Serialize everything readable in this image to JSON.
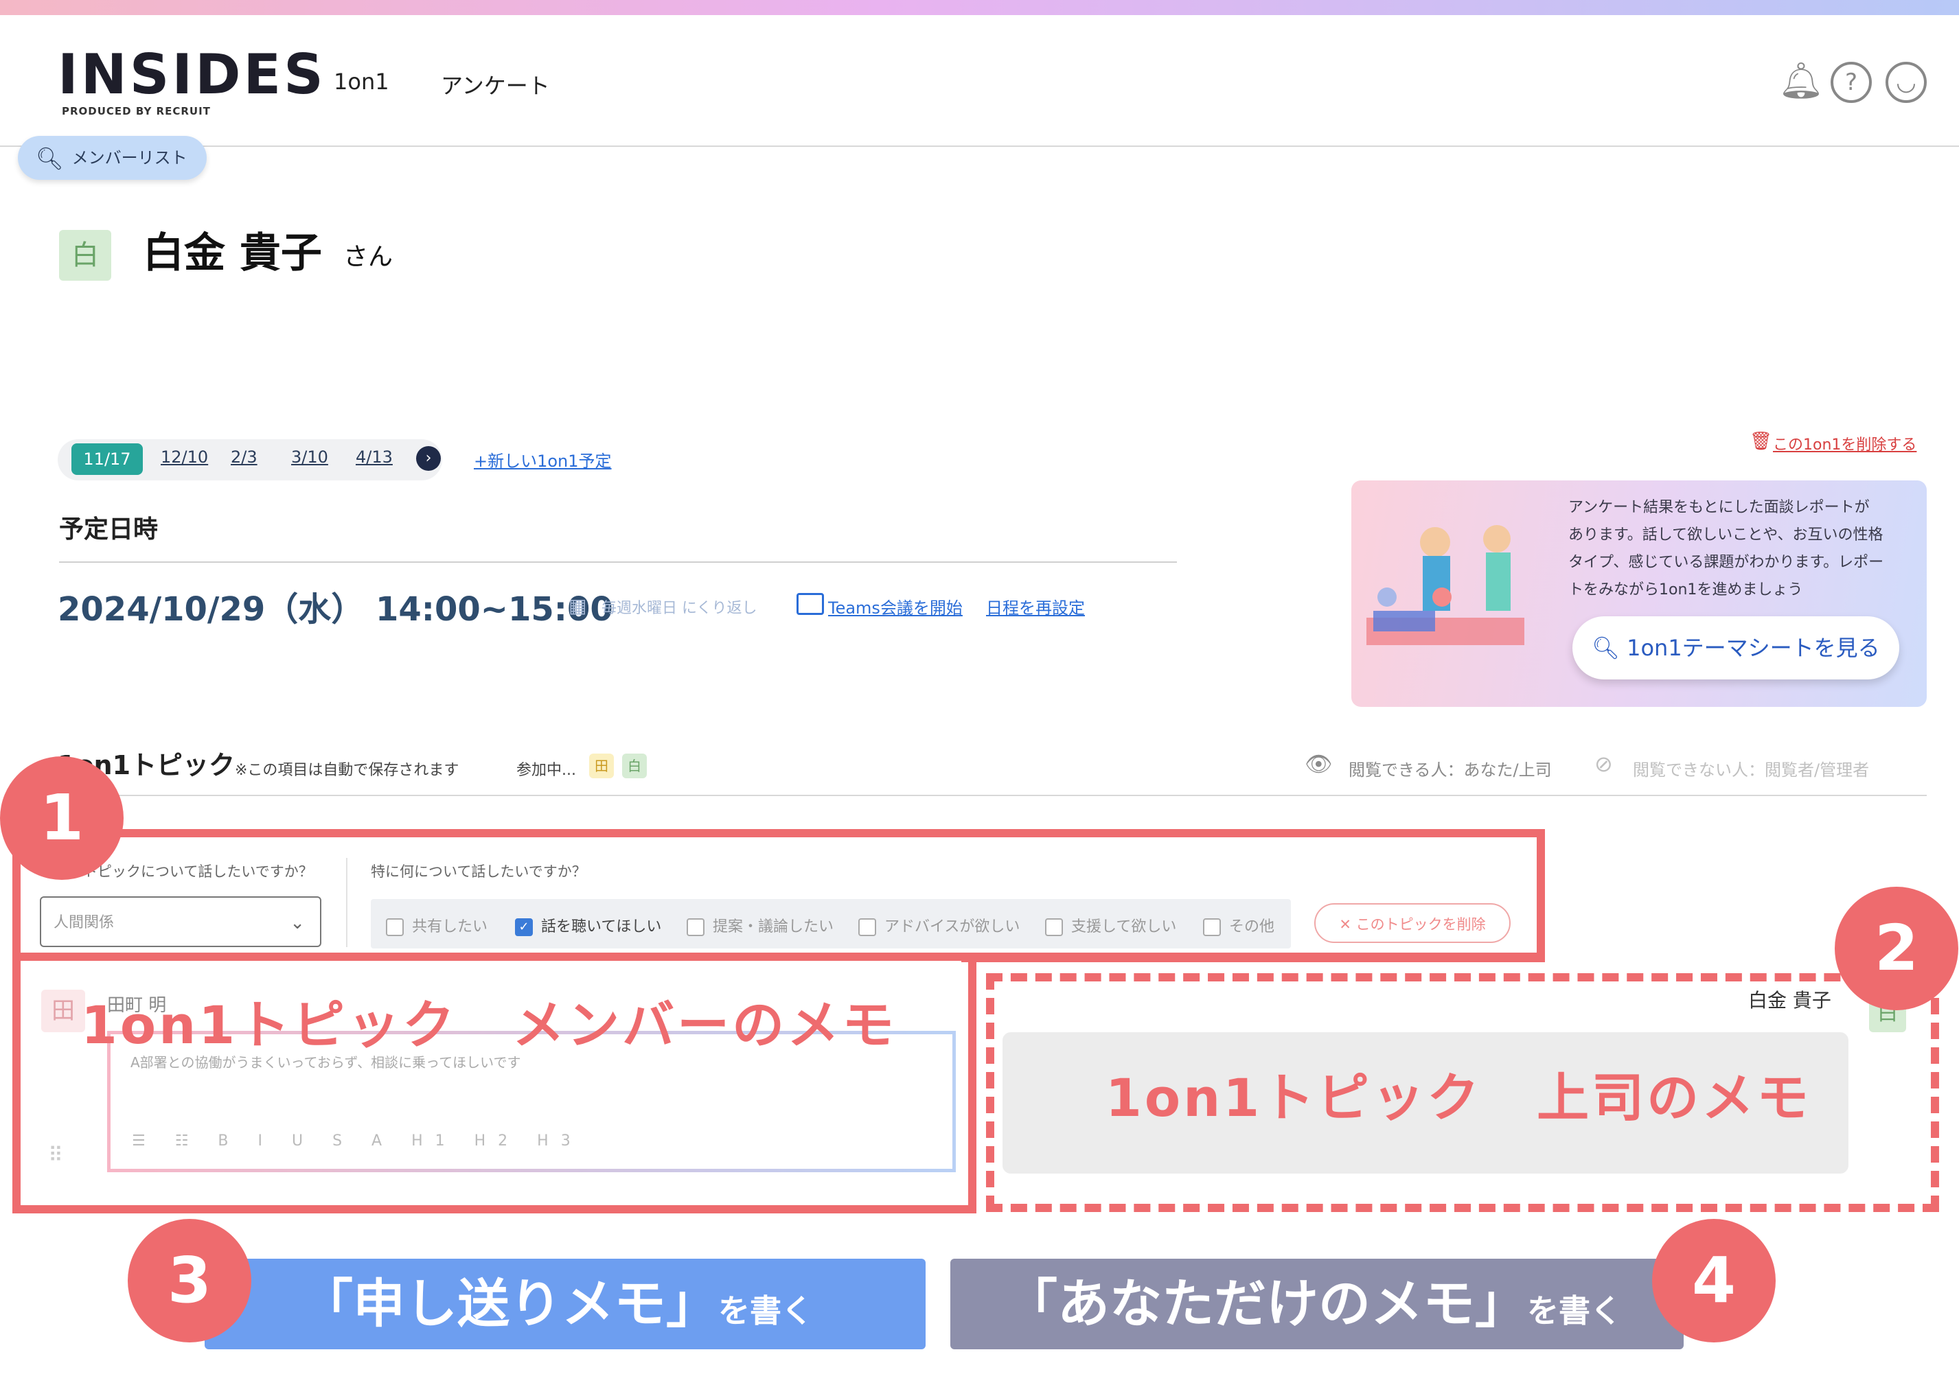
{
  "header": {
    "logo": "INSIDES",
    "logo_sub": "PRODUCED BY RECRUIT",
    "nav": [
      "1on1",
      "アンケート"
    ],
    "member_list": "メンバーリスト"
  },
  "person": {
    "avatar": "白",
    "name": "白金 貴子",
    "honorific": "さん"
  },
  "dates": {
    "tabs": [
      "11/17",
      "12/10",
      "2/3",
      "3/10",
      "4/13"
    ],
    "active_index": 0,
    "new_link": "+新しい1on1予定",
    "delete_link": "この1on1を削除する"
  },
  "schedule": {
    "label": "予定日時",
    "datetime": "2024/10/29（水） 14:00~15:00",
    "repeat": "毎週水曜日 にくり返し",
    "teams": "Teams会議を開始",
    "reschedule": "日程を再設定"
  },
  "promo": {
    "line1": "アンケート結果をもとにした面談レポートが",
    "line2": "あります。話して欲しいことや、お互いの性格",
    "line3": "タイプ、感じている課題がわかります。レポー",
    "line4": "トをみながら1on1を進めましょう",
    "button": "1on1テーマシートを見る"
  },
  "topics": {
    "title": "1on1トピック",
    "note": "※この項目は自動で保存されます",
    "participants_label": "参加中...",
    "participants": [
      "田",
      "白"
    ],
    "viewable": "閲覧できる人：あなた/上司",
    "not_viewable": "閲覧できない人：閲覧者/管理者",
    "q1": "どんなトピックについて話したいですか？",
    "q2": "特に何について話したいですか？",
    "select_value": "人間関係",
    "options": [
      "共有したい",
      "話を聴いてほしい",
      "提案・議論したい",
      "アドバイスが欲しい",
      "支援して欲しい",
      "その他"
    ],
    "checked": "話を聴いてほしい",
    "delete_topic": "このトピックを削除",
    "member_avatar": "田",
    "member_name": "田町 明",
    "memo_placeholder": "A部署との協働がうまくいっておらず、相談に乗ってほしいです",
    "toolbar": "☰ ☷ B I U S A H1 H2 H3",
    "manager_name": "白金 貴子",
    "manager_avatar": "白"
  },
  "overlay": {
    "member_memo": "1on1トピック　メンバーのメモ",
    "manager_memo": "1on1トピック　上司のメモ",
    "num1": "1",
    "num2": "2",
    "num3": "3",
    "num4": "4",
    "btn1_main": "「申し送りメモ」",
    "btn1_suffix": "を書く",
    "btn2_main": "「あなただけのメモ」",
    "btn2_suffix": "を書く"
  },
  "colors": {
    "accent_red": "#ee6b6e",
    "teal": "#27a59a",
    "blue_btn": "#6d9ef0",
    "gray_btn": "#8d8fab"
  },
  "icons": [
    "search-icon",
    "bell-icon",
    "help-icon",
    "user-icon",
    "calendar-icon",
    "video-icon",
    "trash-icon",
    "eye-icon",
    "eye-off-icon",
    "chevron-down-icon",
    "chevron-right-icon"
  ]
}
